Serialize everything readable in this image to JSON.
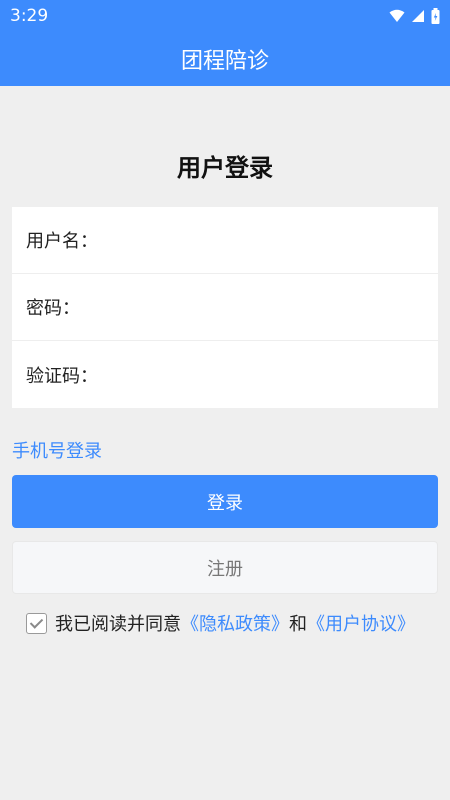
{
  "status_bar": {
    "time": "3:29"
  },
  "app_bar": {
    "title": "团程陪诊"
  },
  "page": {
    "title": "用户登录"
  },
  "form": {
    "username_label": "用户名：",
    "password_label": "密码：",
    "captcha_label": "验证码：",
    "username_value": "",
    "password_value": "",
    "captcha_value": ""
  },
  "phone_login_label": "手机号登录",
  "login_button_label": "登录",
  "register_button_label": "注册",
  "agreement": {
    "checked": true,
    "prefix": "我已阅读并同意",
    "privacy_link": "《隐私政策》",
    "and": "和",
    "terms_link": "《用户协议》"
  },
  "colors": {
    "primary": "#3d8bfd",
    "background": "#efefef"
  }
}
